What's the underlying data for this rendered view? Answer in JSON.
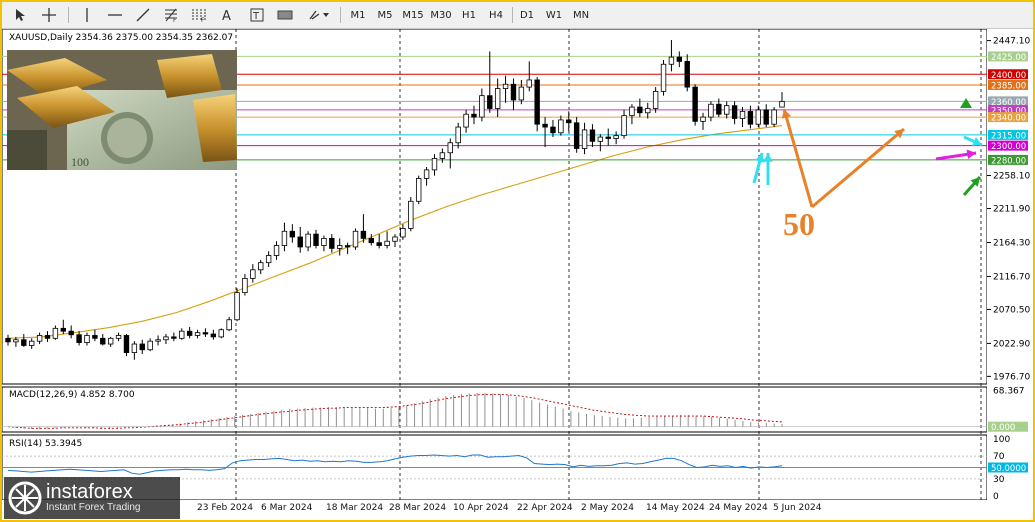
{
  "toolbar": {
    "timeframes": [
      "M1",
      "M5",
      "M15",
      "M30",
      "H1",
      "H4",
      "D1",
      "W1",
      "MN"
    ],
    "tools": [
      "cursor-icon",
      "crosshair-icon",
      "vertical-line-icon",
      "horizontal-line-icon",
      "trendline-icon",
      "fibo-icon",
      "text-label-icon",
      "text-icon",
      "label-icon",
      "rectangle-icon",
      "arrows-icon"
    ]
  },
  "chart_data": {
    "type": "candlestick",
    "symbol_line": "XAUUSD,Daily  2354.36 2375.00 2354.35 2362.07",
    "y_ticks": [
      "2447.10",
      "2258.10",
      "2211.90",
      "2164.30",
      "2116.70",
      "2070.50",
      "2022.90",
      "1976.70"
    ],
    "price_levels": [
      {
        "label": "2425.00",
        "value": 2425,
        "color": "#a8d08d"
      },
      {
        "label": "2400.00",
        "value": 2400,
        "color": "#d00000"
      },
      {
        "label": "2385.00",
        "value": 2385,
        "color": "#e0701a"
      },
      {
        "label": "2360.00",
        "value": 2362,
        "color": "#9aa8b0"
      },
      {
        "label": "2350.00",
        "value": 2350,
        "color": "#c040c0"
      },
      {
        "label": "2340.00",
        "value": 2340,
        "color": "#e8a040"
      },
      {
        "label": "2315.00",
        "value": 2315,
        "color": "#00c8e0"
      },
      {
        "label": "2300.00",
        "value": 2300,
        "color": "#d000d0"
      },
      {
        "label": "2280.00",
        "value": 2280,
        "color": "#3a9a30"
      }
    ],
    "ma_label": "50",
    "ma_values": [
      2030,
      2032,
      2038,
      2045,
      2054,
      2066,
      2082,
      2100,
      2118,
      2136,
      2156,
      2176,
      2196,
      2214,
      2230,
      2244,
      2258,
      2272,
      2286,
      2298,
      2308,
      2316,
      2322,
      2328
    ],
    "ma_dates": [
      "2024-01-22",
      "2024-01-31",
      "2024-02-09",
      "2024-02-20",
      "2024-02-29",
      "2024-03-09",
      "2024-03-18",
      "2024-03-27",
      "2024-04-05",
      "2024-04-14",
      "2024-04-23",
      "2024-05-02",
      "2024-05-11",
      "2024-05-20",
      "2024-05-29",
      "2024-06-06"
    ],
    "candles": [
      {
        "o": 2030,
        "h": 2035,
        "l": 2020,
        "c": 2025
      },
      {
        "o": 2025,
        "h": 2032,
        "l": 2018,
        "c": 2028
      },
      {
        "o": 2028,
        "h": 2036,
        "l": 2018,
        "c": 2020
      },
      {
        "o": 2020,
        "h": 2030,
        "l": 2015,
        "c": 2026
      },
      {
        "o": 2026,
        "h": 2038,
        "l": 2022,
        "c": 2034
      },
      {
        "o": 2034,
        "h": 2040,
        "l": 2025,
        "c": 2030
      },
      {
        "o": 2030,
        "h": 2048,
        "l": 2028,
        "c": 2044
      },
      {
        "o": 2044,
        "h": 2056,
        "l": 2036,
        "c": 2040
      },
      {
        "o": 2040,
        "h": 2048,
        "l": 2030,
        "c": 2035
      },
      {
        "o": 2035,
        "h": 2040,
        "l": 2020,
        "c": 2024
      },
      {
        "o": 2024,
        "h": 2038,
        "l": 2020,
        "c": 2034
      },
      {
        "o": 2034,
        "h": 2042,
        "l": 2026,
        "c": 2030
      },
      {
        "o": 2030,
        "h": 2036,
        "l": 2020,
        "c": 2022
      },
      {
        "o": 2022,
        "h": 2032,
        "l": 2018,
        "c": 2030
      },
      {
        "o": 2030,
        "h": 2038,
        "l": 2026,
        "c": 2034
      },
      {
        "o": 2034,
        "h": 2036,
        "l": 2005,
        "c": 2010
      },
      {
        "o": 2010,
        "h": 2026,
        "l": 2000,
        "c": 2022
      },
      {
        "o": 2022,
        "h": 2028,
        "l": 2008,
        "c": 2014
      },
      {
        "o": 2014,
        "h": 2030,
        "l": 2012,
        "c": 2026
      },
      {
        "o": 2026,
        "h": 2034,
        "l": 2020,
        "c": 2028
      },
      {
        "o": 2028,
        "h": 2036,
        "l": 2022,
        "c": 2032
      },
      {
        "o": 2032,
        "h": 2038,
        "l": 2026,
        "c": 2030
      },
      {
        "o": 2030,
        "h": 2044,
        "l": 2028,
        "c": 2040
      },
      {
        "o": 2040,
        "h": 2046,
        "l": 2030,
        "c": 2034
      },
      {
        "o": 2034,
        "h": 2042,
        "l": 2030,
        "c": 2038
      },
      {
        "o": 2038,
        "h": 2044,
        "l": 2032,
        "c": 2036
      },
      {
        "o": 2036,
        "h": 2042,
        "l": 2028,
        "c": 2032
      },
      {
        "o": 2032,
        "h": 2044,
        "l": 2030,
        "c": 2042
      },
      {
        "o": 2042,
        "h": 2060,
        "l": 2040,
        "c": 2056
      },
      {
        "o": 2056,
        "h": 2100,
        "l": 2054,
        "c": 2094
      },
      {
        "o": 2094,
        "h": 2120,
        "l": 2090,
        "c": 2114
      },
      {
        "o": 2114,
        "h": 2134,
        "l": 2108,
        "c": 2126
      },
      {
        "o": 2126,
        "h": 2140,
        "l": 2120,
        "c": 2136
      },
      {
        "o": 2136,
        "h": 2152,
        "l": 2130,
        "c": 2146
      },
      {
        "o": 2146,
        "h": 2166,
        "l": 2140,
        "c": 2160
      },
      {
        "o": 2160,
        "h": 2192,
        "l": 2152,
        "c": 2180
      },
      {
        "o": 2180,
        "h": 2190,
        "l": 2164,
        "c": 2172
      },
      {
        "o": 2172,
        "h": 2186,
        "l": 2150,
        "c": 2158
      },
      {
        "o": 2158,
        "h": 2180,
        "l": 2152,
        "c": 2176
      },
      {
        "o": 2176,
        "h": 2182,
        "l": 2156,
        "c": 2160
      },
      {
        "o": 2160,
        "h": 2174,
        "l": 2152,
        "c": 2170
      },
      {
        "o": 2170,
        "h": 2176,
        "l": 2150,
        "c": 2156
      },
      {
        "o": 2156,
        "h": 2170,
        "l": 2146,
        "c": 2160
      },
      {
        "o": 2160,
        "h": 2164,
        "l": 2148,
        "c": 2158
      },
      {
        "o": 2158,
        "h": 2184,
        "l": 2154,
        "c": 2180
      },
      {
        "o": 2180,
        "h": 2204,
        "l": 2164,
        "c": 2170
      },
      {
        "o": 2170,
        "h": 2176,
        "l": 2160,
        "c": 2164
      },
      {
        "o": 2164,
        "h": 2176,
        "l": 2156,
        "c": 2160
      },
      {
        "o": 2160,
        "h": 2180,
        "l": 2156,
        "c": 2166
      },
      {
        "o": 2166,
        "h": 2176,
        "l": 2158,
        "c": 2172
      },
      {
        "o": 2172,
        "h": 2190,
        "l": 2168,
        "c": 2184
      },
      {
        "o": 2184,
        "h": 2228,
        "l": 2180,
        "c": 2222
      },
      {
        "o": 2222,
        "h": 2258,
        "l": 2218,
        "c": 2254
      },
      {
        "o": 2254,
        "h": 2270,
        "l": 2244,
        "c": 2266
      },
      {
        "o": 2266,
        "h": 2288,
        "l": 2258,
        "c": 2282
      },
      {
        "o": 2282,
        "h": 2296,
        "l": 2276,
        "c": 2290
      },
      {
        "o": 2290,
        "h": 2310,
        "l": 2268,
        "c": 2304
      },
      {
        "o": 2304,
        "h": 2332,
        "l": 2296,
        "c": 2326
      },
      {
        "o": 2326,
        "h": 2350,
        "l": 2318,
        "c": 2344
      },
      {
        "o": 2344,
        "h": 2356,
        "l": 2330,
        "c": 2340
      },
      {
        "o": 2340,
        "h": 2380,
        "l": 2334,
        "c": 2370
      },
      {
        "o": 2370,
        "h": 2432,
        "l": 2346,
        "c": 2352
      },
      {
        "o": 2352,
        "h": 2394,
        "l": 2340,
        "c": 2380
      },
      {
        "o": 2380,
        "h": 2398,
        "l": 2360,
        "c": 2386
      },
      {
        "o": 2386,
        "h": 2394,
        "l": 2350,
        "c": 2364
      },
      {
        "o": 2364,
        "h": 2392,
        "l": 2358,
        "c": 2382
      },
      {
        "o": 2382,
        "h": 2418,
        "l": 2376,
        "c": 2392
      },
      {
        "o": 2392,
        "h": 2396,
        "l": 2320,
        "c": 2330
      },
      {
        "o": 2330,
        "h": 2340,
        "l": 2298,
        "c": 2326
      },
      {
        "o": 2326,
        "h": 2336,
        "l": 2312,
        "c": 2318
      },
      {
        "o": 2318,
        "h": 2342,
        "l": 2314,
        "c": 2336
      },
      {
        "o": 2336,
        "h": 2348,
        "l": 2320,
        "c": 2332
      },
      {
        "o": 2332,
        "h": 2340,
        "l": 2290,
        "c": 2296
      },
      {
        "o": 2296,
        "h": 2332,
        "l": 2288,
        "c": 2322
      },
      {
        "o": 2322,
        "h": 2330,
        "l": 2298,
        "c": 2306
      },
      {
        "o": 2306,
        "h": 2316,
        "l": 2292,
        "c": 2312
      },
      {
        "o": 2312,
        "h": 2324,
        "l": 2300,
        "c": 2310
      },
      {
        "o": 2310,
        "h": 2320,
        "l": 2302,
        "c": 2314
      },
      {
        "o": 2314,
        "h": 2350,
        "l": 2310,
        "c": 2342
      },
      {
        "o": 2342,
        "h": 2358,
        "l": 2330,
        "c": 2354
      },
      {
        "o": 2354,
        "h": 2366,
        "l": 2340,
        "c": 2346
      },
      {
        "o": 2346,
        "h": 2360,
        "l": 2338,
        "c": 2352
      },
      {
        "o": 2352,
        "h": 2382,
        "l": 2346,
        "c": 2376
      },
      {
        "o": 2376,
        "h": 2420,
        "l": 2370,
        "c": 2414
      },
      {
        "o": 2414,
        "h": 2448,
        "l": 2404,
        "c": 2424
      },
      {
        "o": 2424,
        "h": 2432,
        "l": 2410,
        "c": 2418
      },
      {
        "o": 2418,
        "h": 2428,
        "l": 2376,
        "c": 2382
      },
      {
        "o": 2382,
        "h": 2386,
        "l": 2328,
        "c": 2334
      },
      {
        "o": 2334,
        "h": 2346,
        "l": 2322,
        "c": 2340
      },
      {
        "o": 2340,
        "h": 2362,
        "l": 2334,
        "c": 2358
      },
      {
        "o": 2358,
        "h": 2366,
        "l": 2340,
        "c": 2344
      },
      {
        "o": 2344,
        "h": 2362,
        "l": 2338,
        "c": 2356
      },
      {
        "o": 2356,
        "h": 2362,
        "l": 2330,
        "c": 2338
      },
      {
        "o": 2338,
        "h": 2354,
        "l": 2326,
        "c": 2348
      },
      {
        "o": 2348,
        "h": 2356,
        "l": 2324,
        "c": 2330
      },
      {
        "o": 2330,
        "h": 2356,
        "l": 2326,
        "c": 2350
      },
      {
        "o": 2350,
        "h": 2358,
        "l": 2326,
        "c": 2330
      },
      {
        "o": 2330,
        "h": 2354,
        "l": 2326,
        "c": 2350
      },
      {
        "o": 2354,
        "h": 2375,
        "l": 2354,
        "c": 2362
      }
    ],
    "x_labels": [
      "23 Feb 2024",
      "6 Mar 2024",
      "18 Mar 2024",
      "28 Mar 2024",
      "10 Apr 2024",
      "22 Apr 2024",
      "2 May 2024",
      "14 May 2024",
      "24 May 2024",
      "5 Jun 2024"
    ],
    "macd": {
      "label": "MACD(12,26,9) 4.852 8.700",
      "ticks": [
        "68.367",
        "0.000"
      ],
      "hist_values": [
        0,
        -2,
        -3,
        -4,
        -5,
        -4,
        -3,
        -2,
        -1,
        -1,
        -2,
        -3,
        -4,
        -4,
        -3,
        -2,
        -1,
        0,
        1,
        2,
        3,
        4,
        6,
        8,
        10,
        12,
        14,
        16,
        18,
        20,
        22,
        24,
        26,
        28,
        30,
        32,
        33,
        34,
        35,
        36,
        36,
        37,
        37,
        36,
        36,
        35,
        35,
        34,
        34,
        35,
        37,
        40,
        44,
        48,
        52,
        55,
        58,
        60,
        62,
        63,
        64,
        64,
        63,
        62,
        60,
        57,
        54,
        50,
        46,
        42,
        38,
        34,
        30,
        27,
        24,
        22,
        20,
        18,
        17,
        16,
        16,
        17,
        18,
        19,
        20,
        21,
        22,
        22,
        21,
        20,
        19,
        17,
        15,
        13,
        11,
        9,
        8,
        7,
        6,
        5
      ],
      "signal_values": [
        0,
        -1,
        -2,
        -3,
        -3,
        -3,
        -3,
        -2,
        -2,
        -2,
        -2,
        -2,
        -3,
        -3,
        -3,
        -2,
        -2,
        -1,
        0,
        1,
        2,
        3,
        4,
        6,
        7,
        9,
        11,
        13,
        15,
        17,
        19,
        21,
        23,
        25,
        26,
        28,
        29,
        31,
        32,
        33,
        34,
        35,
        35,
        36,
        36,
        36,
        36,
        36,
        36,
        37,
        38,
        40,
        42,
        44,
        47,
        50,
        53,
        55,
        57,
        59,
        60,
        61,
        61,
        61,
        60,
        59,
        57,
        55,
        52,
        49,
        46,
        43,
        40,
        37,
        34,
        31,
        29,
        27,
        25,
        23,
        22,
        21,
        20,
        20,
        20,
        20,
        20,
        20,
        20,
        20,
        19,
        18,
        17,
        16,
        15,
        13,
        12,
        11,
        10,
        9
      ]
    },
    "rsi": {
      "label": "RSI(14) 53.3945",
      "ticks": [
        "100",
        "70",
        "50.0000",
        "30",
        "0"
      ],
      "values": [
        45,
        44,
        43,
        42,
        43,
        44,
        45,
        46,
        47,
        46,
        45,
        44,
        43,
        44,
        45,
        46,
        40,
        38,
        41,
        44,
        45,
        46,
        46,
        47,
        46,
        46,
        45,
        46,
        48,
        58,
        62,
        63,
        64,
        64,
        65,
        66,
        64,
        62,
        63,
        61,
        62,
        60,
        61,
        60,
        62,
        61,
        59,
        59,
        60,
        62,
        65,
        68,
        70,
        71,
        71,
        72,
        71,
        70,
        71,
        69,
        72,
        72,
        68,
        69,
        69,
        70,
        71,
        67,
        57,
        56,
        55,
        56,
        55,
        51,
        54,
        52,
        53,
        53,
        54,
        57,
        58,
        56,
        57,
        60,
        63,
        66,
        66,
        62,
        55,
        50,
        51,
        54,
        52,
        53,
        50,
        52,
        49,
        51,
        50,
        51,
        53
      ]
    }
  }
}
